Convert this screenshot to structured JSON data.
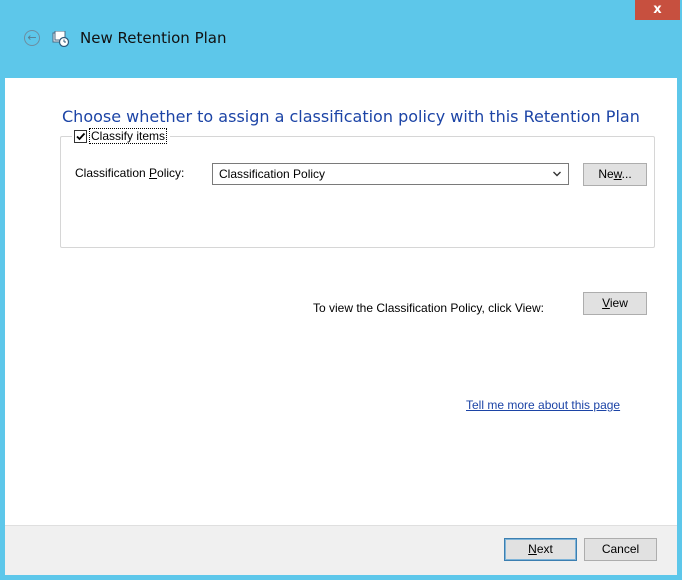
{
  "window": {
    "title": "New Retention Plan",
    "close_label": "x"
  },
  "heading": "Choose whether to assign a classification policy with this Retention Plan",
  "classify": {
    "checkbox_label": "Classify items",
    "checked": true
  },
  "policy": {
    "label_pre": "Classification ",
    "label_accel": "P",
    "label_post": "olicy:",
    "selected": "Classification Policy",
    "new_pre": "Ne",
    "new_accel": "w",
    "new_post": "...",
    "view_hint": "To view the Classification Policy, click View:",
    "view_accel": "V",
    "view_post": "iew"
  },
  "link_text": "Tell me more about this page",
  "footer": {
    "next_accel": "N",
    "next_post": "ext",
    "cancel_label": "Cancel"
  },
  "colors": {
    "title_bar": "#5dc7ea",
    "heading": "#1c44a6",
    "close_button": "#c7503f"
  },
  "icons": {
    "back": "back-arrow-icon",
    "app": "retention-plan-icon",
    "dropdown": "chevron-down-icon",
    "checkbox": "checkmark-icon"
  }
}
